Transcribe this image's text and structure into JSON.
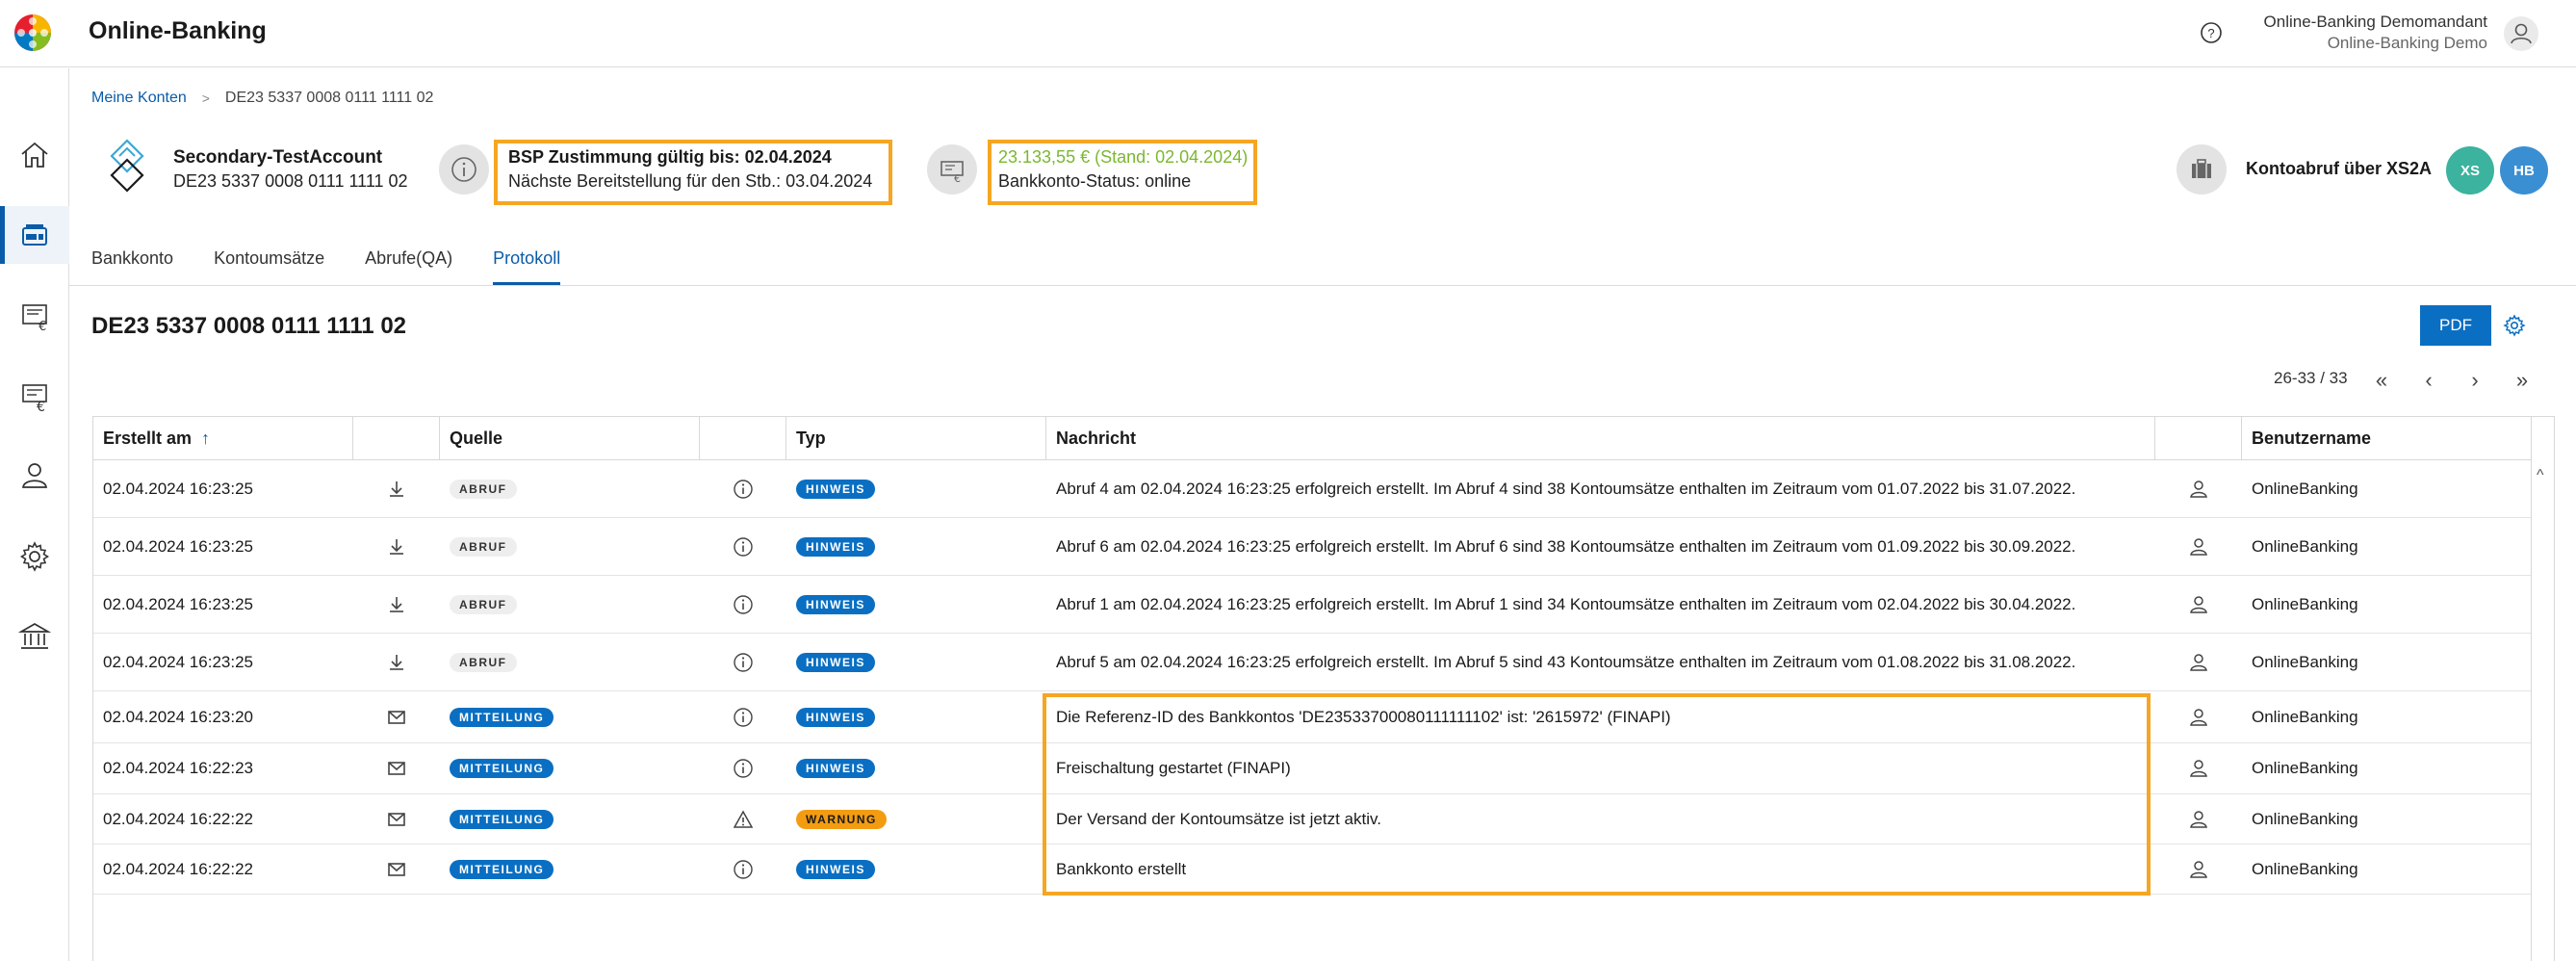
{
  "app": {
    "title": "Online-Banking",
    "user_name": "Online-Banking Demomandant",
    "user_sub": "Online-Banking Demo"
  },
  "sidebar": {
    "items": [
      {
        "name": "home-icon"
      },
      {
        "name": "wallet-icon",
        "active": true
      },
      {
        "name": "invoice-euro-icon"
      },
      {
        "name": "document-euro-icon"
      },
      {
        "name": "user-icon"
      },
      {
        "name": "gear-icon"
      },
      {
        "name": "bank-icon"
      }
    ]
  },
  "breadcrumb": {
    "root": "Meine Konten",
    "current": "DE23 5337 0008 0111 1111 02"
  },
  "account": {
    "name": "Secondary-TestAccount",
    "iban": "DE23 5337 0008 0111 1111 02",
    "bsp_title": "BSP Zustimmung gültig bis: 02.04.2024",
    "bsp_next": "Nächste Bereitstellung für den Stb.: 03.04.2024",
    "balance": "23.133,55 € (Stand: 02.04.2024)",
    "status": "Bankkonto-Status: online",
    "xs2a_label": "Kontoabruf über XS2A",
    "badges": [
      "XS",
      "HB"
    ]
  },
  "colors": {
    "accent": "#0a5ca8",
    "highlight": "#f5a623",
    "balance_green": "#7ab82f",
    "badge_xs": "#3bb39e",
    "badge_hb": "#3a8fd3"
  },
  "tabs": [
    "Bankkonto",
    "Kontoumsätze",
    "Abrufe(QA)",
    "Protokoll"
  ],
  "active_tab": "Protokoll",
  "content": {
    "title": "DE23 5337 0008 0111 1111 02",
    "pdf_label": "PDF",
    "pager": "26-33 / 33"
  },
  "table": {
    "columns": [
      "Erstellt am",
      "",
      "Quelle",
      "",
      "Typ",
      "Nachricht",
      "",
      "Benutzername"
    ],
    "sort_indicator": "↑",
    "rows": [
      {
        "date": "02.04.2024 16:23:25",
        "kind": "download-icon",
        "source": "ABRUF",
        "type": "HINWEIS",
        "type_icon": "info-icon",
        "message": "Abruf 4 am 02.04.2024 16:23:25 erfolgreich erstellt. Im Abruf 4 sind 38 Kontoumsätze enthalten im Zeitraum vom 01.07.2022 bis 31.07.2022.",
        "user": "OnlineBanking"
      },
      {
        "date": "02.04.2024 16:23:25",
        "kind": "download-icon",
        "source": "ABRUF",
        "type": "HINWEIS",
        "type_icon": "info-icon",
        "message": "Abruf 6 am 02.04.2024 16:23:25 erfolgreich erstellt. Im Abruf 6 sind 38 Kontoumsätze enthalten im Zeitraum vom 01.09.2022 bis 30.09.2022.",
        "user": "OnlineBanking"
      },
      {
        "date": "02.04.2024 16:23:25",
        "kind": "download-icon",
        "source": "ABRUF",
        "type": "HINWEIS",
        "type_icon": "info-icon",
        "message": "Abruf 1 am 02.04.2024 16:23:25 erfolgreich erstellt. Im Abruf 1 sind 34 Kontoumsätze enthalten im Zeitraum vom 02.04.2022 bis 30.04.2022.",
        "user": "OnlineBanking"
      },
      {
        "date": "02.04.2024 16:23:25",
        "kind": "download-icon",
        "source": "ABRUF",
        "type": "HINWEIS",
        "type_icon": "info-icon",
        "message": "Abruf 5 am 02.04.2024 16:23:25 erfolgreich erstellt. Im Abruf 5 sind 43 Kontoumsätze enthalten im Zeitraum vom 01.08.2022 bis 31.08.2022.",
        "user": "OnlineBanking"
      },
      {
        "date": "02.04.2024 16:23:20",
        "kind": "mail-icon",
        "source": "MITTEILUNG",
        "type": "HINWEIS",
        "type_icon": "info-icon",
        "message": "Die Referenz-ID des Bankkontos 'DE23533700080111111102' ist: '2615972' (FINAPI)",
        "user": "OnlineBanking"
      },
      {
        "date": "02.04.2024 16:22:23",
        "kind": "mail-icon",
        "source": "MITTEILUNG",
        "type": "HINWEIS",
        "type_icon": "info-icon",
        "message": "Freischaltung gestartet (FINAPI)",
        "user": "OnlineBanking"
      },
      {
        "date": "02.04.2024 16:22:22",
        "kind": "mail-icon",
        "source": "MITTEILUNG",
        "type": "WARNUNG",
        "type_icon": "warning-icon",
        "message": "Der Versand der Kontoumsätze ist jetzt aktiv.",
        "user": "OnlineBanking"
      },
      {
        "date": "02.04.2024 16:22:22",
        "kind": "mail-icon",
        "source": "MITTEILUNG",
        "type": "HINWEIS",
        "type_icon": "info-icon",
        "message": "Bankkonto erstellt",
        "user": "OnlineBanking"
      }
    ]
  }
}
